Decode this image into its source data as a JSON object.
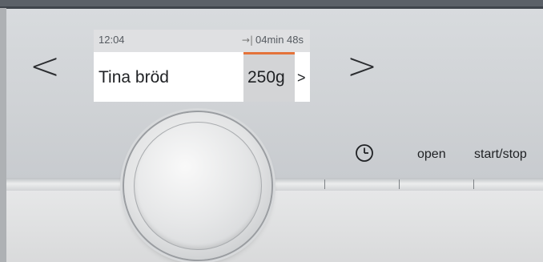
{
  "display": {
    "time": "12:04",
    "remaining_icon": "→|",
    "remaining_time": "04min 48s",
    "program": "Tina bröd",
    "weight": "250g",
    "more_arrow": ">"
  },
  "navigation": {
    "prev_label": "<",
    "next_label": ">"
  },
  "buttons": {
    "timer_icon": "clock-icon",
    "open_label": "open",
    "start_stop_label": "start/stop"
  },
  "colors": {
    "accent": "#e4733a",
    "panel": "#d3d6d9",
    "display_bg": "#ffffff"
  }
}
